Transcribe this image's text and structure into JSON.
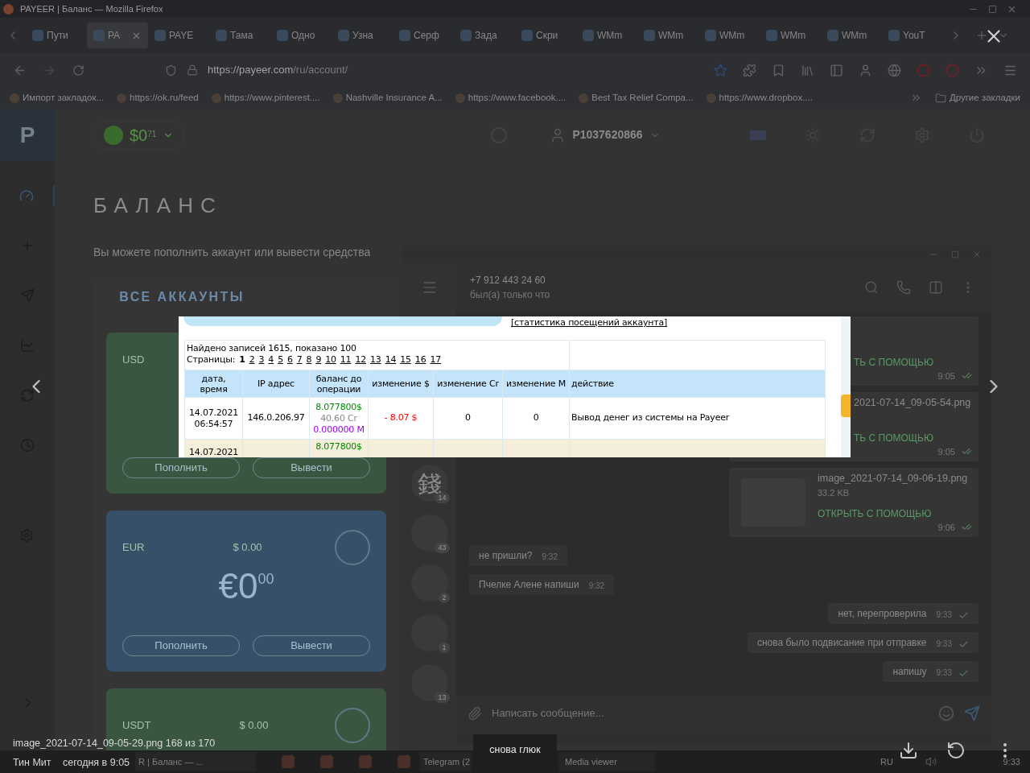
{
  "browser": {
    "title": "PAYEER | Баланс — Mozilla Firefox",
    "tabs": [
      {
        "label": "Пути",
        "selected": false
      },
      {
        "label": "PA",
        "selected": true
      },
      {
        "label": "PAYE",
        "selected": false
      },
      {
        "label": "Тама",
        "selected": false
      },
      {
        "label": "Одно",
        "selected": false
      },
      {
        "label": "Узна",
        "selected": false
      },
      {
        "label": "Серф",
        "selected": false
      },
      {
        "label": "Зада",
        "selected": false
      },
      {
        "label": "Скри",
        "selected": false
      },
      {
        "label": "WMm",
        "selected": false
      },
      {
        "label": "WMm",
        "selected": false
      },
      {
        "label": "WMm",
        "selected": false
      },
      {
        "label": "WMm",
        "selected": false
      },
      {
        "label": "WMm",
        "selected": false
      },
      {
        "label": "YouT",
        "selected": false
      }
    ],
    "url_host": "https://payeer.com",
    "url_path": "/ru/account/",
    "bookmarks": [
      "Импорт закладок...",
      "https://ok.ru/feed",
      "https://www.pinterest....",
      "Nashville Insurance A...",
      "https://www.facebook....",
      "Best Tax Relief Compa...",
      "https://www.dropbox...."
    ],
    "other_bookmarks": "Другие закладки"
  },
  "payeer": {
    "logo": "P",
    "balance": "$0",
    "balance_cents": "71",
    "account": "P1037620866",
    "title": "БАЛАНС",
    "subtitle": "Вы можете пополнить аккаунт или вывести средства",
    "tab": "ВСЕ АККАУНТЫ",
    "accounts": [
      {
        "currency": "USD",
        "color": "#3a5640",
        "buttons": [
          "Пополнить",
          "Вывести"
        ]
      },
      {
        "currency": "EUR",
        "usd": "$ 0.00",
        "symbol": "€",
        "amount": "0",
        "cents": "00",
        "color": "#37506a",
        "buttons": [
          "Пополнить",
          "Вывести"
        ]
      },
      {
        "currency": "USDT",
        "usd": "$ 0.00",
        "color": "#3a5640"
      }
    ]
  },
  "telegram": {
    "contact": "+7 912 443 24 60",
    "status": "был(а) только что",
    "chats": [
      {
        "avatar": "錢",
        "badge": "14"
      },
      {
        "badge": "43"
      },
      {
        "badge": "2"
      },
      {
        "badge": "1"
      },
      {
        "badge": "13"
      }
    ],
    "messages": [
      {
        "kind": "file",
        "action": "ТЬ С ПОМОЩЬЮ",
        "time": "9:05",
        "outgoing": true,
        "read": true
      },
      {
        "kind": "file",
        "name": "2021-07-14_09-05-54.png",
        "action": "ТЬ С ПОМОЩЬЮ",
        "time": "9:05",
        "outgoing": true,
        "read": true
      },
      {
        "kind": "file",
        "name": "image_2021-07-14_09-06-19.png",
        "size": "33.2 KB",
        "action": "ОТКРЫТЬ С ПОМОЩЬЮ",
        "time": "9:06",
        "outgoing": true,
        "read": true
      },
      {
        "kind": "text",
        "text": "не пришли?",
        "time": "9:32",
        "outgoing": false
      },
      {
        "kind": "text",
        "text": "Пчелке Алене напиши",
        "time": "9:32",
        "outgoing": false
      },
      {
        "kind": "text",
        "text": "нет, перепроверила",
        "time": "9:33",
        "outgoing": true,
        "read": false
      },
      {
        "kind": "text",
        "text": "снова было подвисание при отправке",
        "time": "9:33",
        "outgoing": true,
        "read": false
      },
      {
        "kind": "text",
        "text": "напишу",
        "time": "9:33",
        "outgoing": true,
        "read": false
      }
    ],
    "placeholder": "Написать сообщение..."
  },
  "viewer": {
    "filename": "image_2021-07-14_09-05-29.png",
    "counter": "168 из 170",
    "sender": "Тин Мит",
    "date": "сегодня в 9:05",
    "caption": "снова глюк",
    "image": {
      "link": "[статистика посещений аккаунта]",
      "found": "Найдено записей 1615, показано 100",
      "pages_label": "Страницы:",
      "pages": [
        {
          "label": "1",
          "selected": true
        },
        {
          "label": "2",
          "selected": false
        },
        {
          "label": "3",
          "selected": false
        },
        {
          "label": "4",
          "selected": false
        },
        {
          "label": "5",
          "selected": false
        },
        {
          "label": "6",
          "selected": false
        },
        {
          "label": "7",
          "selected": false
        },
        {
          "label": "8",
          "selected": false
        },
        {
          "label": "9",
          "selected": false
        },
        {
          "label": "10",
          "selected": false
        },
        {
          "label": "11",
          "selected": false
        },
        {
          "label": "12",
          "selected": false
        },
        {
          "label": "13",
          "selected": false
        },
        {
          "label": "14",
          "selected": false
        },
        {
          "label": "15",
          "selected": false
        },
        {
          "label": "16",
          "selected": false
        },
        {
          "label": "17",
          "selected": false
        }
      ],
      "columns": [
        "дата, время",
        "IP адрес",
        "баланс до операции",
        "изменение $",
        "изменение Cr",
        "изменение M",
        "действие"
      ],
      "rows": [
        {
          "date": "14.07.2021",
          "time": "06:54:57",
          "ip": "146.0.206.97",
          "balance": [
            "8.077800$",
            "40.60 Cr",
            "0.000000 M"
          ],
          "change_usd": "- 8.07 $",
          "color": "#ff0000",
          "change_cr": "0",
          "change_m": "0",
          "action": "Вывод денег из системы на Payeer"
        },
        {
          "date": "14.07.2021",
          "balance": [
            "8.077800$"
          ]
        }
      ]
    }
  },
  "taskbar": {
    "items": [
      "R | Баланс — ...",
      "Telegram (2",
      "Media viewer"
    ],
    "language": "RU",
    "clock": "9:33"
  }
}
